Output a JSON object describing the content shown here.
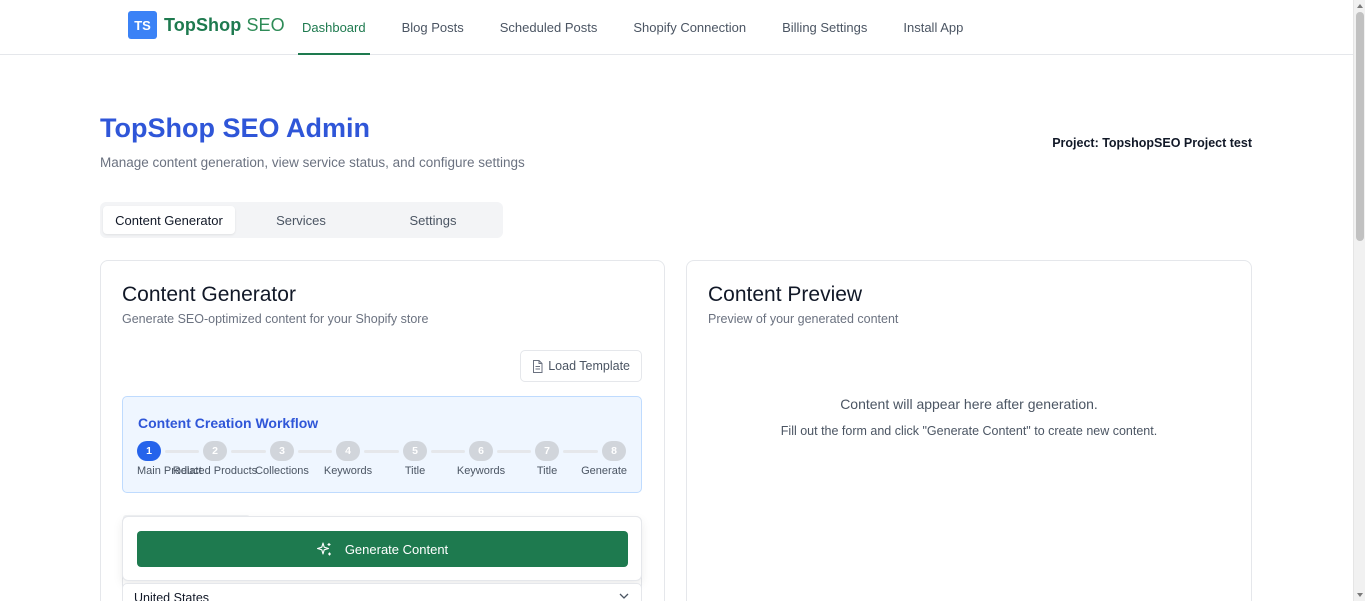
{
  "brand": {
    "badge": "TS",
    "name_bold": "TopShop",
    "name_light": "SEO"
  },
  "nav": [
    {
      "label": "Dashboard",
      "active": true
    },
    {
      "label": "Blog Posts",
      "active": false
    },
    {
      "label": "Scheduled Posts",
      "active": false
    },
    {
      "label": "Shopify Connection",
      "active": false
    },
    {
      "label": "Billing Settings",
      "active": false
    },
    {
      "label": "Install App",
      "active": false
    }
  ],
  "header": {
    "title": "TopShop SEO Admin",
    "subtitle": "Manage content generation, view service status, and configure settings",
    "project": "Project: TopshopSEO Project test"
  },
  "tabs": [
    {
      "label": "Content Generator",
      "active": true
    },
    {
      "label": "Services",
      "active": false
    },
    {
      "label": "Settings",
      "active": false
    }
  ],
  "generator": {
    "title": "Content Generator",
    "subtitle": "Generate SEO-optimized content for your Shopify store",
    "load_template": "Load Template",
    "workflow_title": "Content Creation Workflow",
    "current_step": 1,
    "steps": [
      {
        "num": "1",
        "label": "Main Product"
      },
      {
        "num": "2",
        "label": "Related Products"
      },
      {
        "num": "3",
        "label": "Collections"
      },
      {
        "num": "4",
        "label": "Keywords"
      },
      {
        "num": "5",
        "label": "Title"
      },
      {
        "num": "6",
        "label": "Keywords"
      },
      {
        "num": "7",
        "label": "Title"
      },
      {
        "num": "8",
        "label": "Generate"
      }
    ],
    "generate_button": "Generate Content",
    "country_value": "United States"
  },
  "preview": {
    "title": "Content Preview",
    "subtitle": "Preview of your generated content",
    "empty_main": "Content will appear here after generation.",
    "empty_hint": "Fill out the form and click \"Generate Content\" to create new content."
  },
  "colors": {
    "brand_green": "#1e7a4f",
    "title_blue": "#2f56d8",
    "step_active": "#2563eb"
  }
}
